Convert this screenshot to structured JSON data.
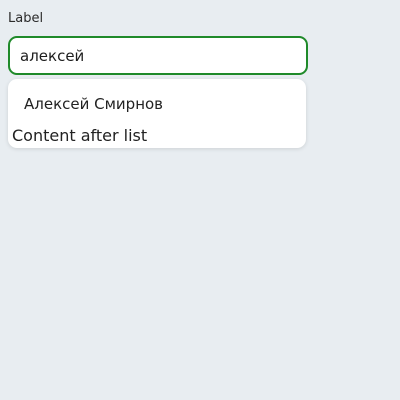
{
  "field": {
    "label": "Label",
    "value": "алексей"
  },
  "suggestions": [
    {
      "label": "Алексей Смирнов"
    }
  ],
  "after_list_text": "Content after list",
  "colors": {
    "background": "#e8edf1",
    "focus_border": "#1f8a2a"
  }
}
